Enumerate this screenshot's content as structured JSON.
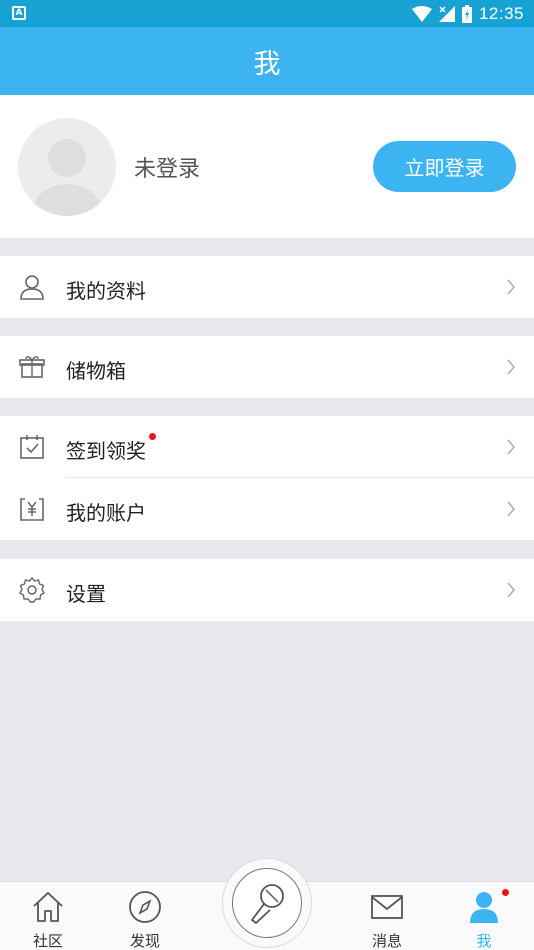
{
  "status_bar": {
    "time": "12:35"
  },
  "header": {
    "title": "我"
  },
  "profile": {
    "status": "未登录",
    "login_label": "立即登录"
  },
  "menu": {
    "profile_label": "我的资料",
    "storage_label": "储物箱",
    "checkin_label": "签到领奖",
    "account_label": "我的账户",
    "settings_label": "设置"
  },
  "tabs": [
    {
      "label": "社区",
      "icon": "home-icon"
    },
    {
      "label": "发现",
      "icon": "compass-icon"
    },
    {
      "label": "",
      "icon": "microphone-icon"
    },
    {
      "label": "消息",
      "icon": "envelope-icon"
    },
    {
      "label": "我",
      "icon": "user-icon"
    }
  ],
  "colors": {
    "status_bar": "#17a2d4",
    "accent": "#3cb4f2",
    "background": "#e9e8ed",
    "notification_dot": "#f0101a"
  }
}
